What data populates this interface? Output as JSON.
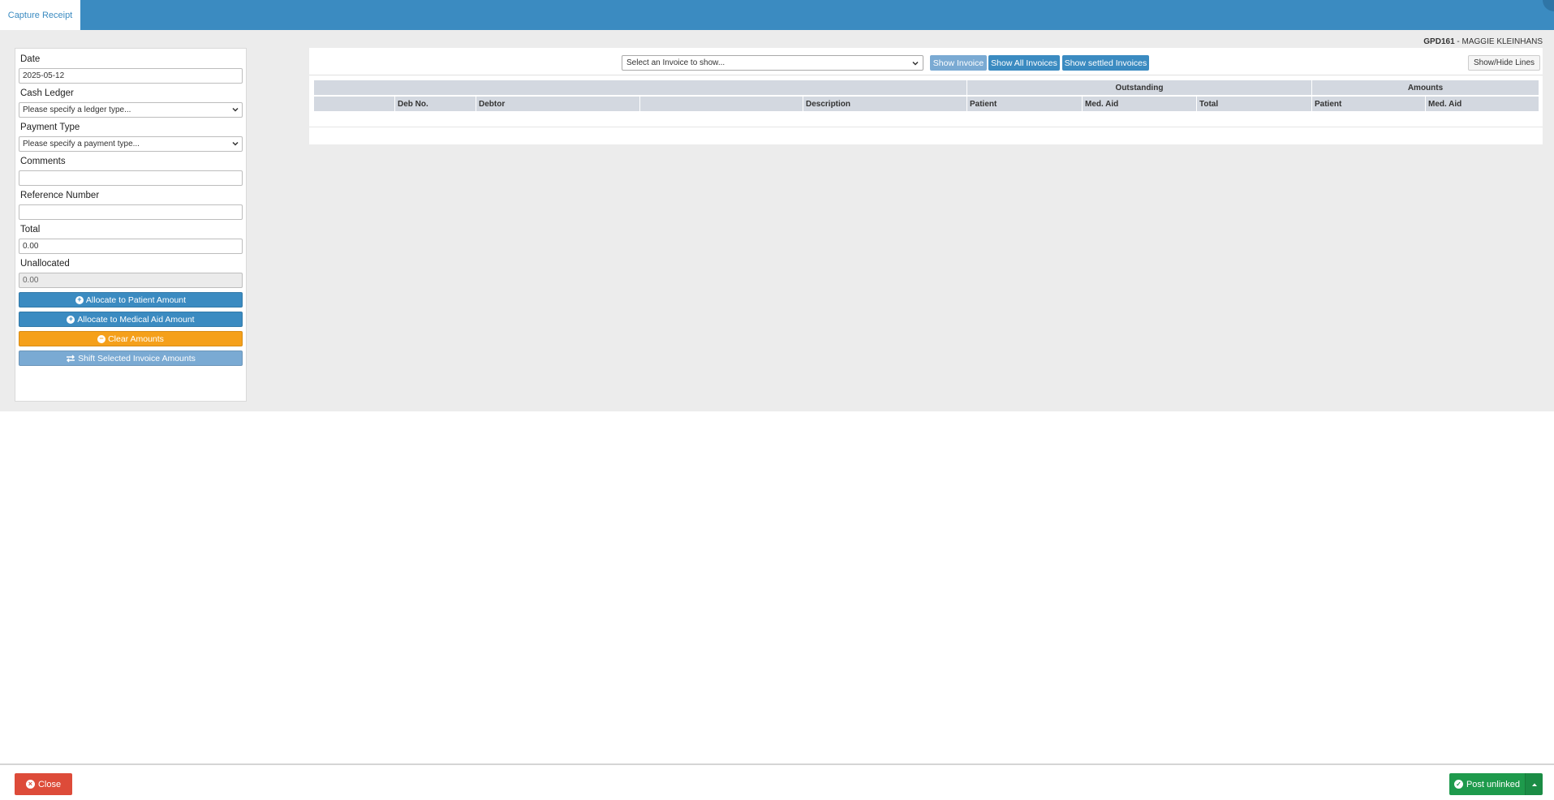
{
  "header": {
    "active_tab": "Capture Receipt",
    "brand_color": "#3b8bc1"
  },
  "practice": {
    "code": "GPD161",
    "separator": " - ",
    "name": "MAGGIE KLEINHANS"
  },
  "form": {
    "date_label": "Date",
    "date_value": "2025-05-12",
    "cash_ledger_label": "Cash Ledger",
    "cash_ledger_placeholder": "Please specify a ledger type...",
    "payment_type_label": "Payment Type",
    "payment_type_placeholder": "Please specify a payment type...",
    "comments_label": "Comments",
    "comments_value": "",
    "reference_label": "Reference Number",
    "reference_value": "",
    "total_label": "Total",
    "total_value": "0.00",
    "unallocated_label": "Unallocated",
    "unallocated_value": "0.00"
  },
  "actions": {
    "allocate_patient": "Allocate to Patient Amount",
    "allocate_medical_aid": "Allocate to Medical Aid Amount",
    "clear_amounts": "Clear Amounts",
    "shift_amounts": "Shift Selected Invoice Amounts"
  },
  "toolbar": {
    "invoice_select_placeholder": "Select an Invoice to show...",
    "show_invoice": "Show Invoice",
    "show_all_invoices": "Show All Invoices",
    "show_settled_invoices": "Show settled Invoices",
    "show_hide_lines": "Show/Hide Lines"
  },
  "table": {
    "group_headers": {
      "outstanding": "Outstanding",
      "amounts": "Amounts"
    },
    "columns": [
      "",
      "Deb No.",
      "Debtor",
      "",
      "Description",
      "Patient",
      "Med. Aid",
      "Total",
      "Patient",
      "Med. Aid"
    ],
    "rows": []
  },
  "footer": {
    "close_label": "Close",
    "post_label": "Post unlinked"
  },
  "colors": {
    "primary": "#3b8bc1",
    "warning": "#f5a01a",
    "danger": "#dd4b39",
    "success": "#1e9a4c",
    "disabled_primary": "#7aaad3"
  }
}
